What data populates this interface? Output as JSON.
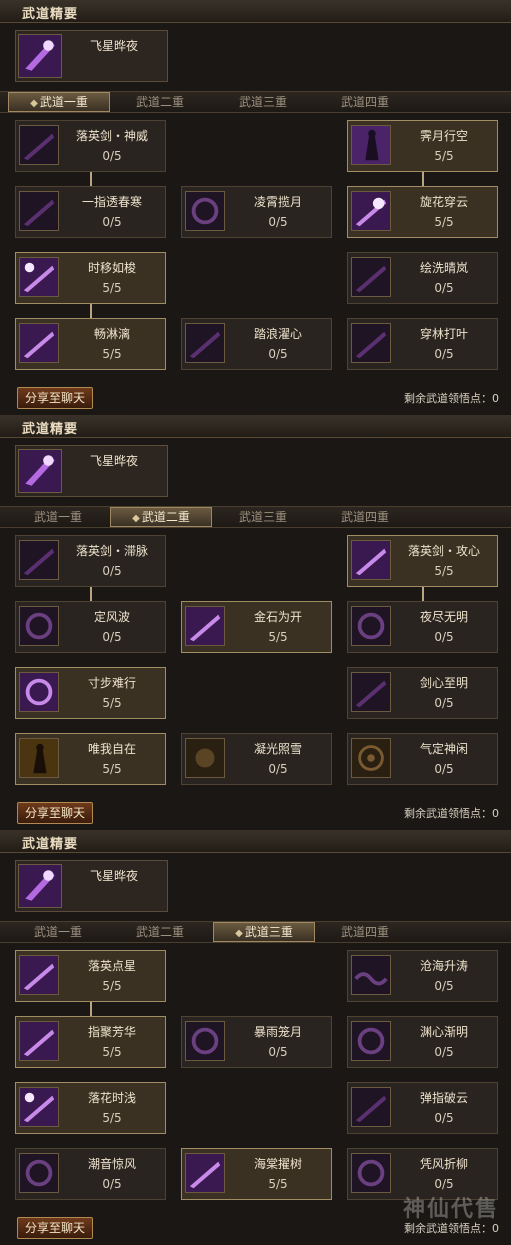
{
  "panels": [
    {
      "header": "武道精要",
      "jingyao": {
        "name": "飞星晔夜",
        "icon": "night-star-icon"
      },
      "tabs": [
        "武道一重",
        "武道二重",
        "武道三重",
        "武道四重"
      ],
      "active_tab": 0,
      "skills": [
        {
          "name": "落英剑・神威",
          "level": "0/5",
          "active": false,
          "icon": "sword-slash-icon"
        },
        {
          "name": "霁月行空",
          "level": "5/5",
          "active": true,
          "icon": "figure-silhouette-icon"
        },
        {
          "name": "一指透春寒",
          "level": "0/5",
          "active": false,
          "icon": "sword-slash-icon"
        },
        {
          "name": "凌霄揽月",
          "level": "0/5",
          "active": false,
          "icon": "swirl-icon"
        },
        {
          "name": "旋花穿云",
          "level": "5/5",
          "active": true,
          "icon": "flower-burst-icon"
        },
        {
          "name": "时移如梭",
          "level": "5/5",
          "active": true,
          "icon": "moon-slash-icon"
        },
        {
          "name": "绘洗晴岚",
          "level": "0/5",
          "active": false,
          "icon": "moon-slash-icon"
        },
        {
          "name": "畅淋漓",
          "level": "5/5",
          "active": true,
          "icon": "sword-slash-icon"
        },
        {
          "name": "踏浪濯心",
          "level": "0/5",
          "active": false,
          "icon": "sword-slash-icon"
        },
        {
          "name": "穿林打叶",
          "level": "0/5",
          "active": false,
          "icon": "sword-slash-icon"
        }
      ],
      "share_label": "分享至聊天",
      "remaining_label": "剩余武道领悟点：0"
    },
    {
      "header": "武道精要",
      "jingyao": {
        "name": "飞星晔夜",
        "icon": "night-star-icon"
      },
      "tabs": [
        "武道一重",
        "武道二重",
        "武道三重",
        "武道四重"
      ],
      "active_tab": 1,
      "skills": [
        {
          "name": "落英剑・滞脉",
          "level": "0/5",
          "active": false,
          "icon": "sword-slash-icon"
        },
        {
          "name": "落英剑・攻心",
          "level": "5/5",
          "active": true,
          "icon": "sword-slash-icon"
        },
        {
          "name": "定风波",
          "level": "0/5",
          "active": false,
          "icon": "swirl-icon"
        },
        {
          "name": "金石为开",
          "level": "5/5",
          "active": true,
          "icon": "sword-slash-icon"
        },
        {
          "name": "夜尽无明",
          "level": "0/5",
          "active": false,
          "icon": "swirl-icon"
        },
        {
          "name": "寸步难行",
          "level": "5/5",
          "active": true,
          "icon": "swirl-icon"
        },
        {
          "name": "剑心至明",
          "level": "0/5",
          "active": false,
          "icon": "sword-slash-icon"
        },
        {
          "name": "唯我自在",
          "level": "5/5",
          "active": true,
          "icon": "figure-silhouette-icon"
        },
        {
          "name": "凝光照雪",
          "level": "0/5",
          "active": false,
          "icon": "glow-icon"
        },
        {
          "name": "气定神闲",
          "level": "0/5",
          "active": false,
          "icon": "meditation-icon"
        }
      ],
      "share_label": "分享至聊天",
      "remaining_label": "剩余武道领悟点：0"
    },
    {
      "header": "武道精要",
      "jingyao": {
        "name": "飞星晔夜",
        "icon": "night-star-icon"
      },
      "tabs": [
        "武道一重",
        "武道二重",
        "武道三重",
        "武道四重"
      ],
      "active_tab": 2,
      "skills": [
        {
          "name": "落英点星",
          "level": "5/5",
          "active": true,
          "icon": "sword-slash-icon"
        },
        {
          "name": "沧海升涛",
          "level": "0/5",
          "active": false,
          "icon": "wave-icon"
        },
        {
          "name": "指聚芳华",
          "level": "5/5",
          "active": true,
          "icon": "sword-slash-icon"
        },
        {
          "name": "暴雨笼月",
          "level": "0/5",
          "active": false,
          "icon": "swirl-icon"
        },
        {
          "name": "渊心渐明",
          "level": "0/5",
          "active": false,
          "icon": "swirl-icon"
        },
        {
          "name": "落花时浅",
          "level": "5/5",
          "active": true,
          "icon": "moon-slash-icon"
        },
        {
          "name": "弹指破云",
          "level": "0/5",
          "active": false,
          "icon": "sword-slash-icon"
        },
        {
          "name": "潮音惊风",
          "level": "0/5",
          "active": false,
          "icon": "swirl-icon"
        },
        {
          "name": "海棠擢树",
          "level": "5/5",
          "active": true,
          "icon": "sword-slash-icon"
        },
        {
          "name": "凭风折柳",
          "level": "0/5",
          "active": false,
          "icon": "swirl-icon"
        }
      ],
      "share_label": "分享至聊天",
      "remaining_label": "剩余武道领悟点：0"
    }
  ],
  "watermark": "神仙代售"
}
